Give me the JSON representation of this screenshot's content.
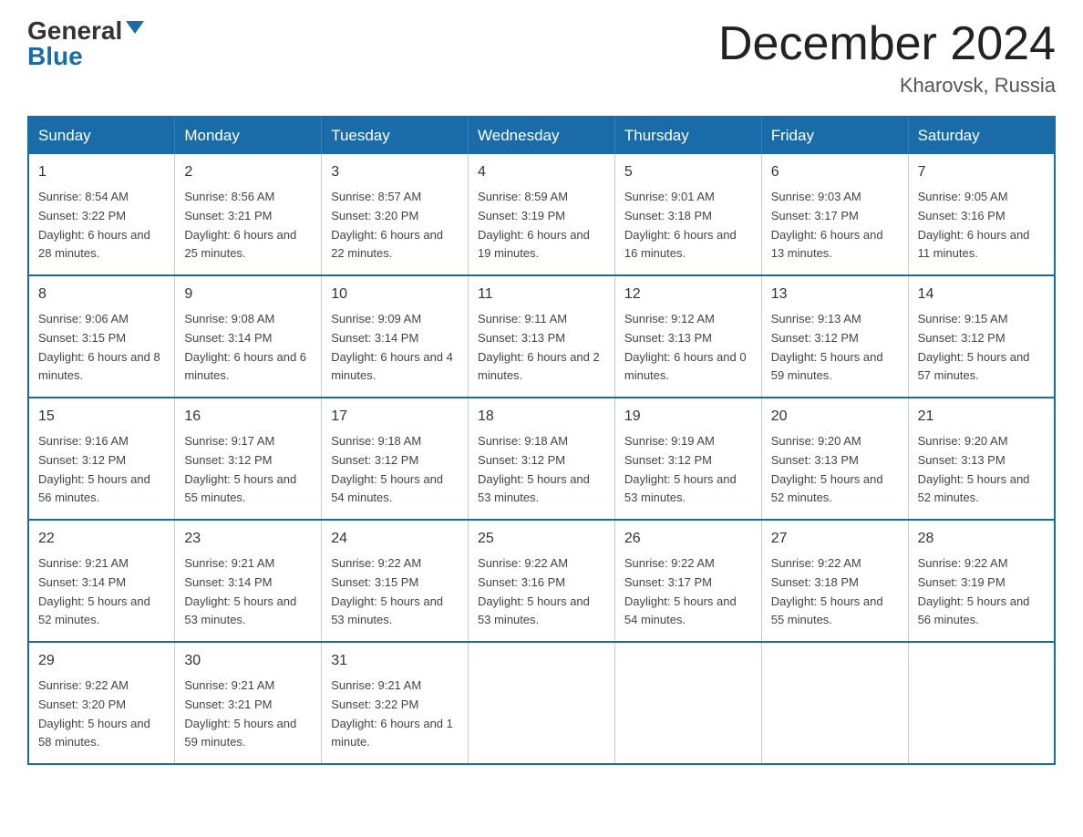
{
  "logo": {
    "general": "General",
    "blue": "Blue"
  },
  "title": "December 2024",
  "subtitle": "Kharovsk, Russia",
  "days_of_week": [
    "Sunday",
    "Monday",
    "Tuesday",
    "Wednesday",
    "Thursday",
    "Friday",
    "Saturday"
  ],
  "weeks": [
    [
      {
        "day": "1",
        "sunrise": "8:54 AM",
        "sunset": "3:22 PM",
        "daylight": "6 hours and 28 minutes."
      },
      {
        "day": "2",
        "sunrise": "8:56 AM",
        "sunset": "3:21 PM",
        "daylight": "6 hours and 25 minutes."
      },
      {
        "day": "3",
        "sunrise": "8:57 AM",
        "sunset": "3:20 PM",
        "daylight": "6 hours and 22 minutes."
      },
      {
        "day": "4",
        "sunrise": "8:59 AM",
        "sunset": "3:19 PM",
        "daylight": "6 hours and 19 minutes."
      },
      {
        "day": "5",
        "sunrise": "9:01 AM",
        "sunset": "3:18 PM",
        "daylight": "6 hours and 16 minutes."
      },
      {
        "day": "6",
        "sunrise": "9:03 AM",
        "sunset": "3:17 PM",
        "daylight": "6 hours and 13 minutes."
      },
      {
        "day": "7",
        "sunrise": "9:05 AM",
        "sunset": "3:16 PM",
        "daylight": "6 hours and 11 minutes."
      }
    ],
    [
      {
        "day": "8",
        "sunrise": "9:06 AM",
        "sunset": "3:15 PM",
        "daylight": "6 hours and 8 minutes."
      },
      {
        "day": "9",
        "sunrise": "9:08 AM",
        "sunset": "3:14 PM",
        "daylight": "6 hours and 6 minutes."
      },
      {
        "day": "10",
        "sunrise": "9:09 AM",
        "sunset": "3:14 PM",
        "daylight": "6 hours and 4 minutes."
      },
      {
        "day": "11",
        "sunrise": "9:11 AM",
        "sunset": "3:13 PM",
        "daylight": "6 hours and 2 minutes."
      },
      {
        "day": "12",
        "sunrise": "9:12 AM",
        "sunset": "3:13 PM",
        "daylight": "6 hours and 0 minutes."
      },
      {
        "day": "13",
        "sunrise": "9:13 AM",
        "sunset": "3:12 PM",
        "daylight": "5 hours and 59 minutes."
      },
      {
        "day": "14",
        "sunrise": "9:15 AM",
        "sunset": "3:12 PM",
        "daylight": "5 hours and 57 minutes."
      }
    ],
    [
      {
        "day": "15",
        "sunrise": "9:16 AM",
        "sunset": "3:12 PM",
        "daylight": "5 hours and 56 minutes."
      },
      {
        "day": "16",
        "sunrise": "9:17 AM",
        "sunset": "3:12 PM",
        "daylight": "5 hours and 55 minutes."
      },
      {
        "day": "17",
        "sunrise": "9:18 AM",
        "sunset": "3:12 PM",
        "daylight": "5 hours and 54 minutes."
      },
      {
        "day": "18",
        "sunrise": "9:18 AM",
        "sunset": "3:12 PM",
        "daylight": "5 hours and 53 minutes."
      },
      {
        "day": "19",
        "sunrise": "9:19 AM",
        "sunset": "3:12 PM",
        "daylight": "5 hours and 53 minutes."
      },
      {
        "day": "20",
        "sunrise": "9:20 AM",
        "sunset": "3:13 PM",
        "daylight": "5 hours and 52 minutes."
      },
      {
        "day": "21",
        "sunrise": "9:20 AM",
        "sunset": "3:13 PM",
        "daylight": "5 hours and 52 minutes."
      }
    ],
    [
      {
        "day": "22",
        "sunrise": "9:21 AM",
        "sunset": "3:14 PM",
        "daylight": "5 hours and 52 minutes."
      },
      {
        "day": "23",
        "sunrise": "9:21 AM",
        "sunset": "3:14 PM",
        "daylight": "5 hours and 53 minutes."
      },
      {
        "day": "24",
        "sunrise": "9:22 AM",
        "sunset": "3:15 PM",
        "daylight": "5 hours and 53 minutes."
      },
      {
        "day": "25",
        "sunrise": "9:22 AM",
        "sunset": "3:16 PM",
        "daylight": "5 hours and 53 minutes."
      },
      {
        "day": "26",
        "sunrise": "9:22 AM",
        "sunset": "3:17 PM",
        "daylight": "5 hours and 54 minutes."
      },
      {
        "day": "27",
        "sunrise": "9:22 AM",
        "sunset": "3:18 PM",
        "daylight": "5 hours and 55 minutes."
      },
      {
        "day": "28",
        "sunrise": "9:22 AM",
        "sunset": "3:19 PM",
        "daylight": "5 hours and 56 minutes."
      }
    ],
    [
      {
        "day": "29",
        "sunrise": "9:22 AM",
        "sunset": "3:20 PM",
        "daylight": "5 hours and 58 minutes."
      },
      {
        "day": "30",
        "sunrise": "9:21 AM",
        "sunset": "3:21 PM",
        "daylight": "5 hours and 59 minutes."
      },
      {
        "day": "31",
        "sunrise": "9:21 AM",
        "sunset": "3:22 PM",
        "daylight": "6 hours and 1 minute."
      },
      null,
      null,
      null,
      null
    ]
  ]
}
